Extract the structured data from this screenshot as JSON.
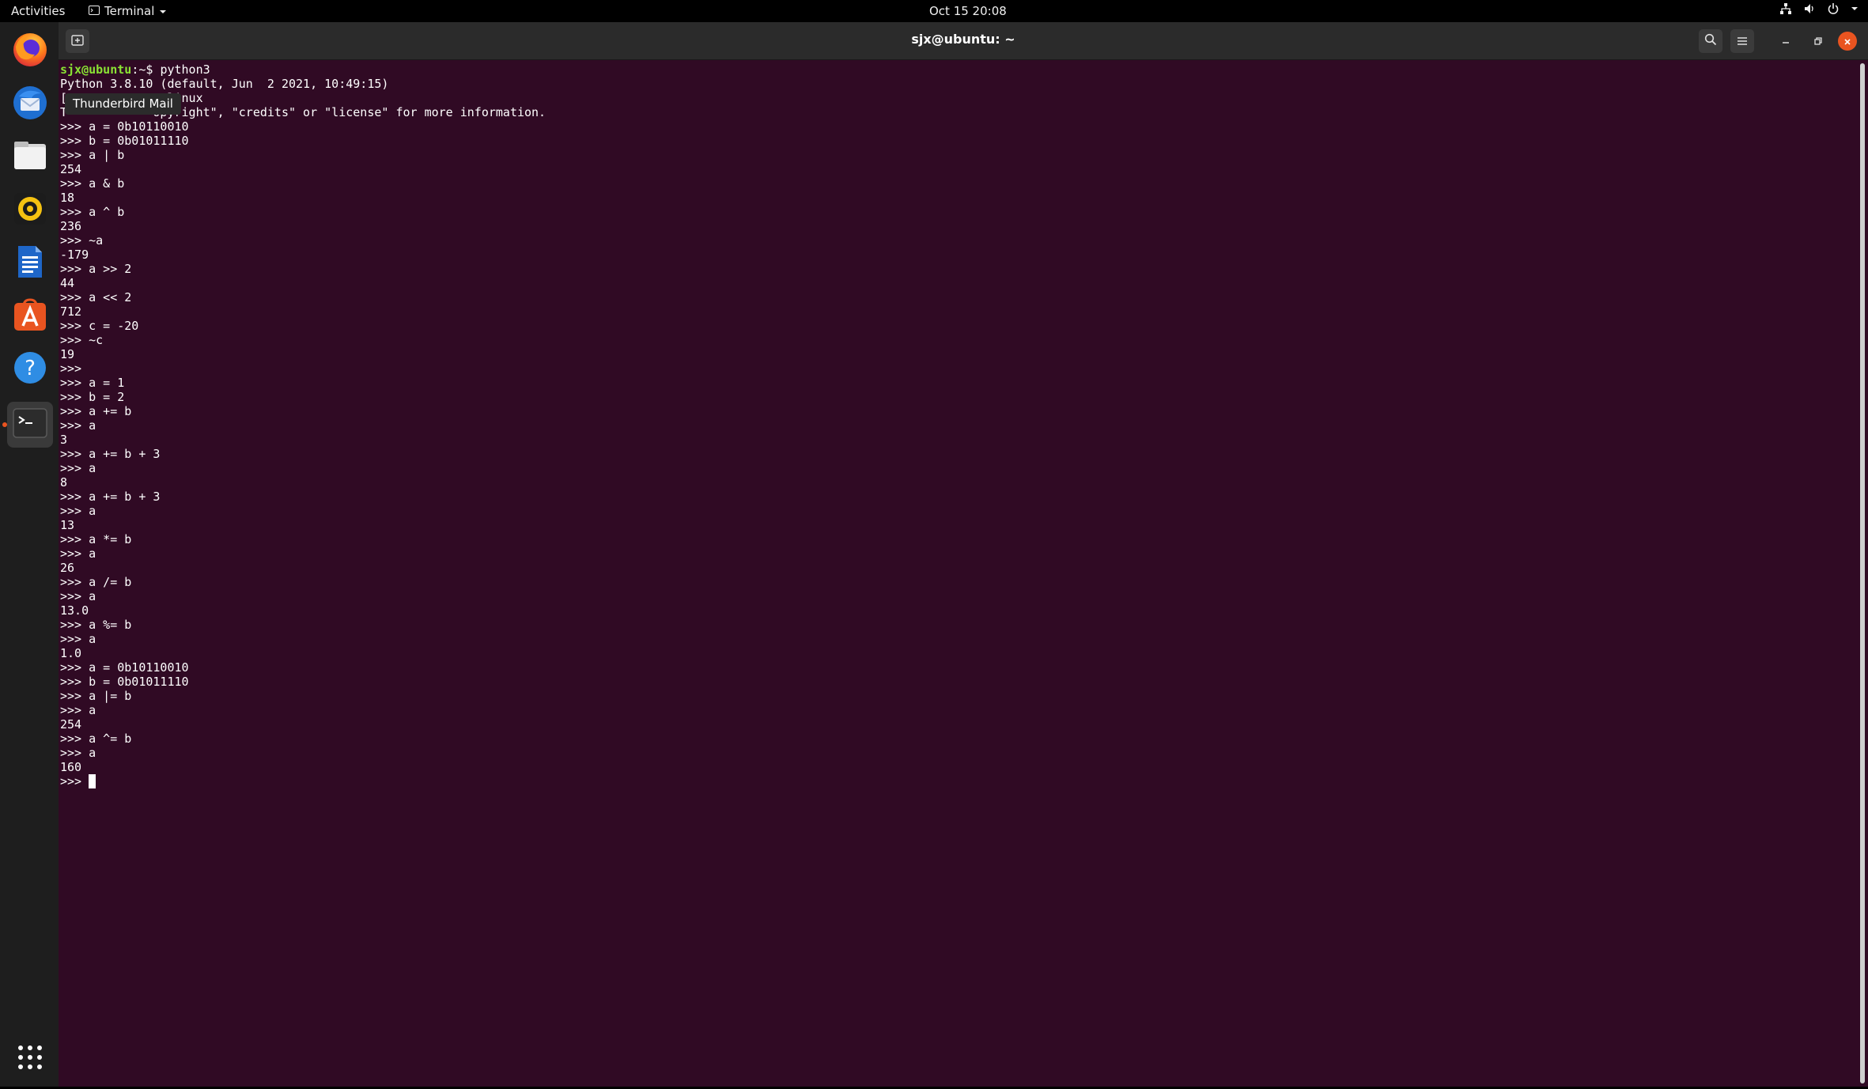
{
  "topbar": {
    "activities": "Activities",
    "app_menu": "Terminal",
    "clock": "Oct 15  20:08",
    "tray_icons": [
      "network-icon",
      "volume-icon",
      "power-icon",
      "chevron-down-icon"
    ]
  },
  "dock": {
    "items": [
      "firefox-icon",
      "thunderbird-icon",
      "files-icon",
      "rhythmbox-icon",
      "writer-icon",
      "software-icon",
      "help-icon",
      "terminal-icon"
    ],
    "show_apps": "app-grid-icon",
    "tooltip": "Thunderbird Mail"
  },
  "window": {
    "title": "sjx@ubuntu: ~"
  },
  "terminal": {
    "prompt_user": "sjx@ubuntu",
    "prompt_sep": ":~$ ",
    "first_command": "python3",
    "lines": [
      "Python 3.8.10 (default, Jun  2 2021, 10:49:15)",
      "[              linux",
      "T            opyright\", \"credits\" or \"license\" for more information.",
      ">>> a = 0b10110010",
      ">>> b = 0b01011110",
      ">>> a | b",
      "254",
      ">>> a & b",
      "18",
      ">>> a ^ b",
      "236",
      ">>> ~a",
      "-179",
      ">>> a >> 2",
      "44",
      ">>> a << 2",
      "712",
      ">>> c = -20",
      ">>> ~c",
      "19",
      ">>>",
      ">>> a = 1",
      ">>> b = 2",
      ">>> a += b",
      ">>> a",
      "3",
      ">>> a += b + 3",
      ">>> a",
      "8",
      ">>> a += b + 3",
      ">>> a",
      "13",
      ">>> a *= b",
      ">>> a",
      "26",
      ">>> a /= b",
      ">>> a",
      "13.0",
      ">>> a %= b",
      ">>> a",
      "1.0",
      ">>> a = 0b10110010",
      ">>> b = 0b01011110",
      ">>> a |= b",
      ">>> a",
      "254",
      ">>> a ^= b",
      ">>> a",
      "160"
    ],
    "last_prompt": ">>> "
  }
}
